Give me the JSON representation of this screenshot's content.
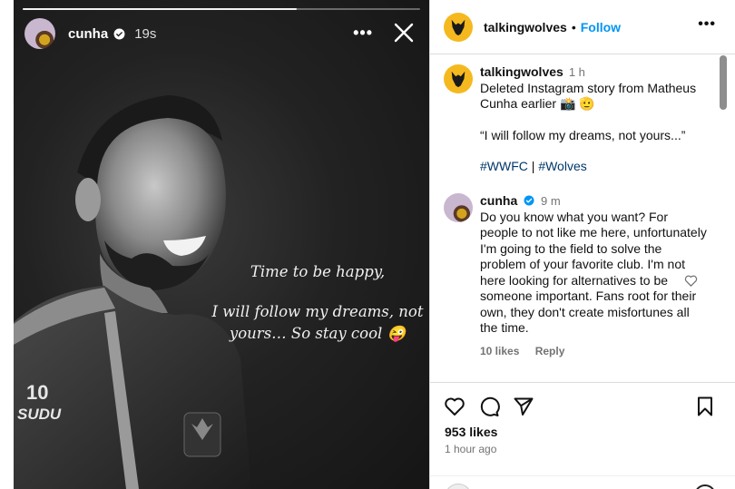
{
  "story": {
    "username": "cunha",
    "time": "19s",
    "progress_fraction": 0.69,
    "caption_line1": "Time to be happy,",
    "caption_line2": "I will follow my dreams, not yours… So stay cool 😜",
    "jersey_number": "10",
    "jersey_brand": "SUDU"
  },
  "post": {
    "header_username": "talkingwolves",
    "follow_label": "Follow",
    "caption_username": "talkingwolves",
    "caption_time": "1 h",
    "caption_text": "Deleted Instagram story from Matheus Cunha earlier 📸 🫡",
    "caption_quote": "“I will follow my dreams, not yours...”",
    "hashtag1": "#WWFC",
    "hashtag_sep": " | ",
    "hashtag2": "#Wolves"
  },
  "comment": {
    "username": "cunha",
    "time": "9 m",
    "text": "Do you know what you want? For people to not like me here, unfortunately I'm going to the field to solve the problem of your favorite club. I'm not here looking for alternatives to be someone important. Fans root for their own, they don't create misfortunes all the time.",
    "likes": "10 likes",
    "reply_label": "Reply"
  },
  "footer": {
    "likes": "953 likes",
    "ago": "1 hour ago"
  },
  "colors": {
    "accent": "#0095f6",
    "hashtag": "#00376b",
    "wolves_gold": "#f5b91f"
  }
}
